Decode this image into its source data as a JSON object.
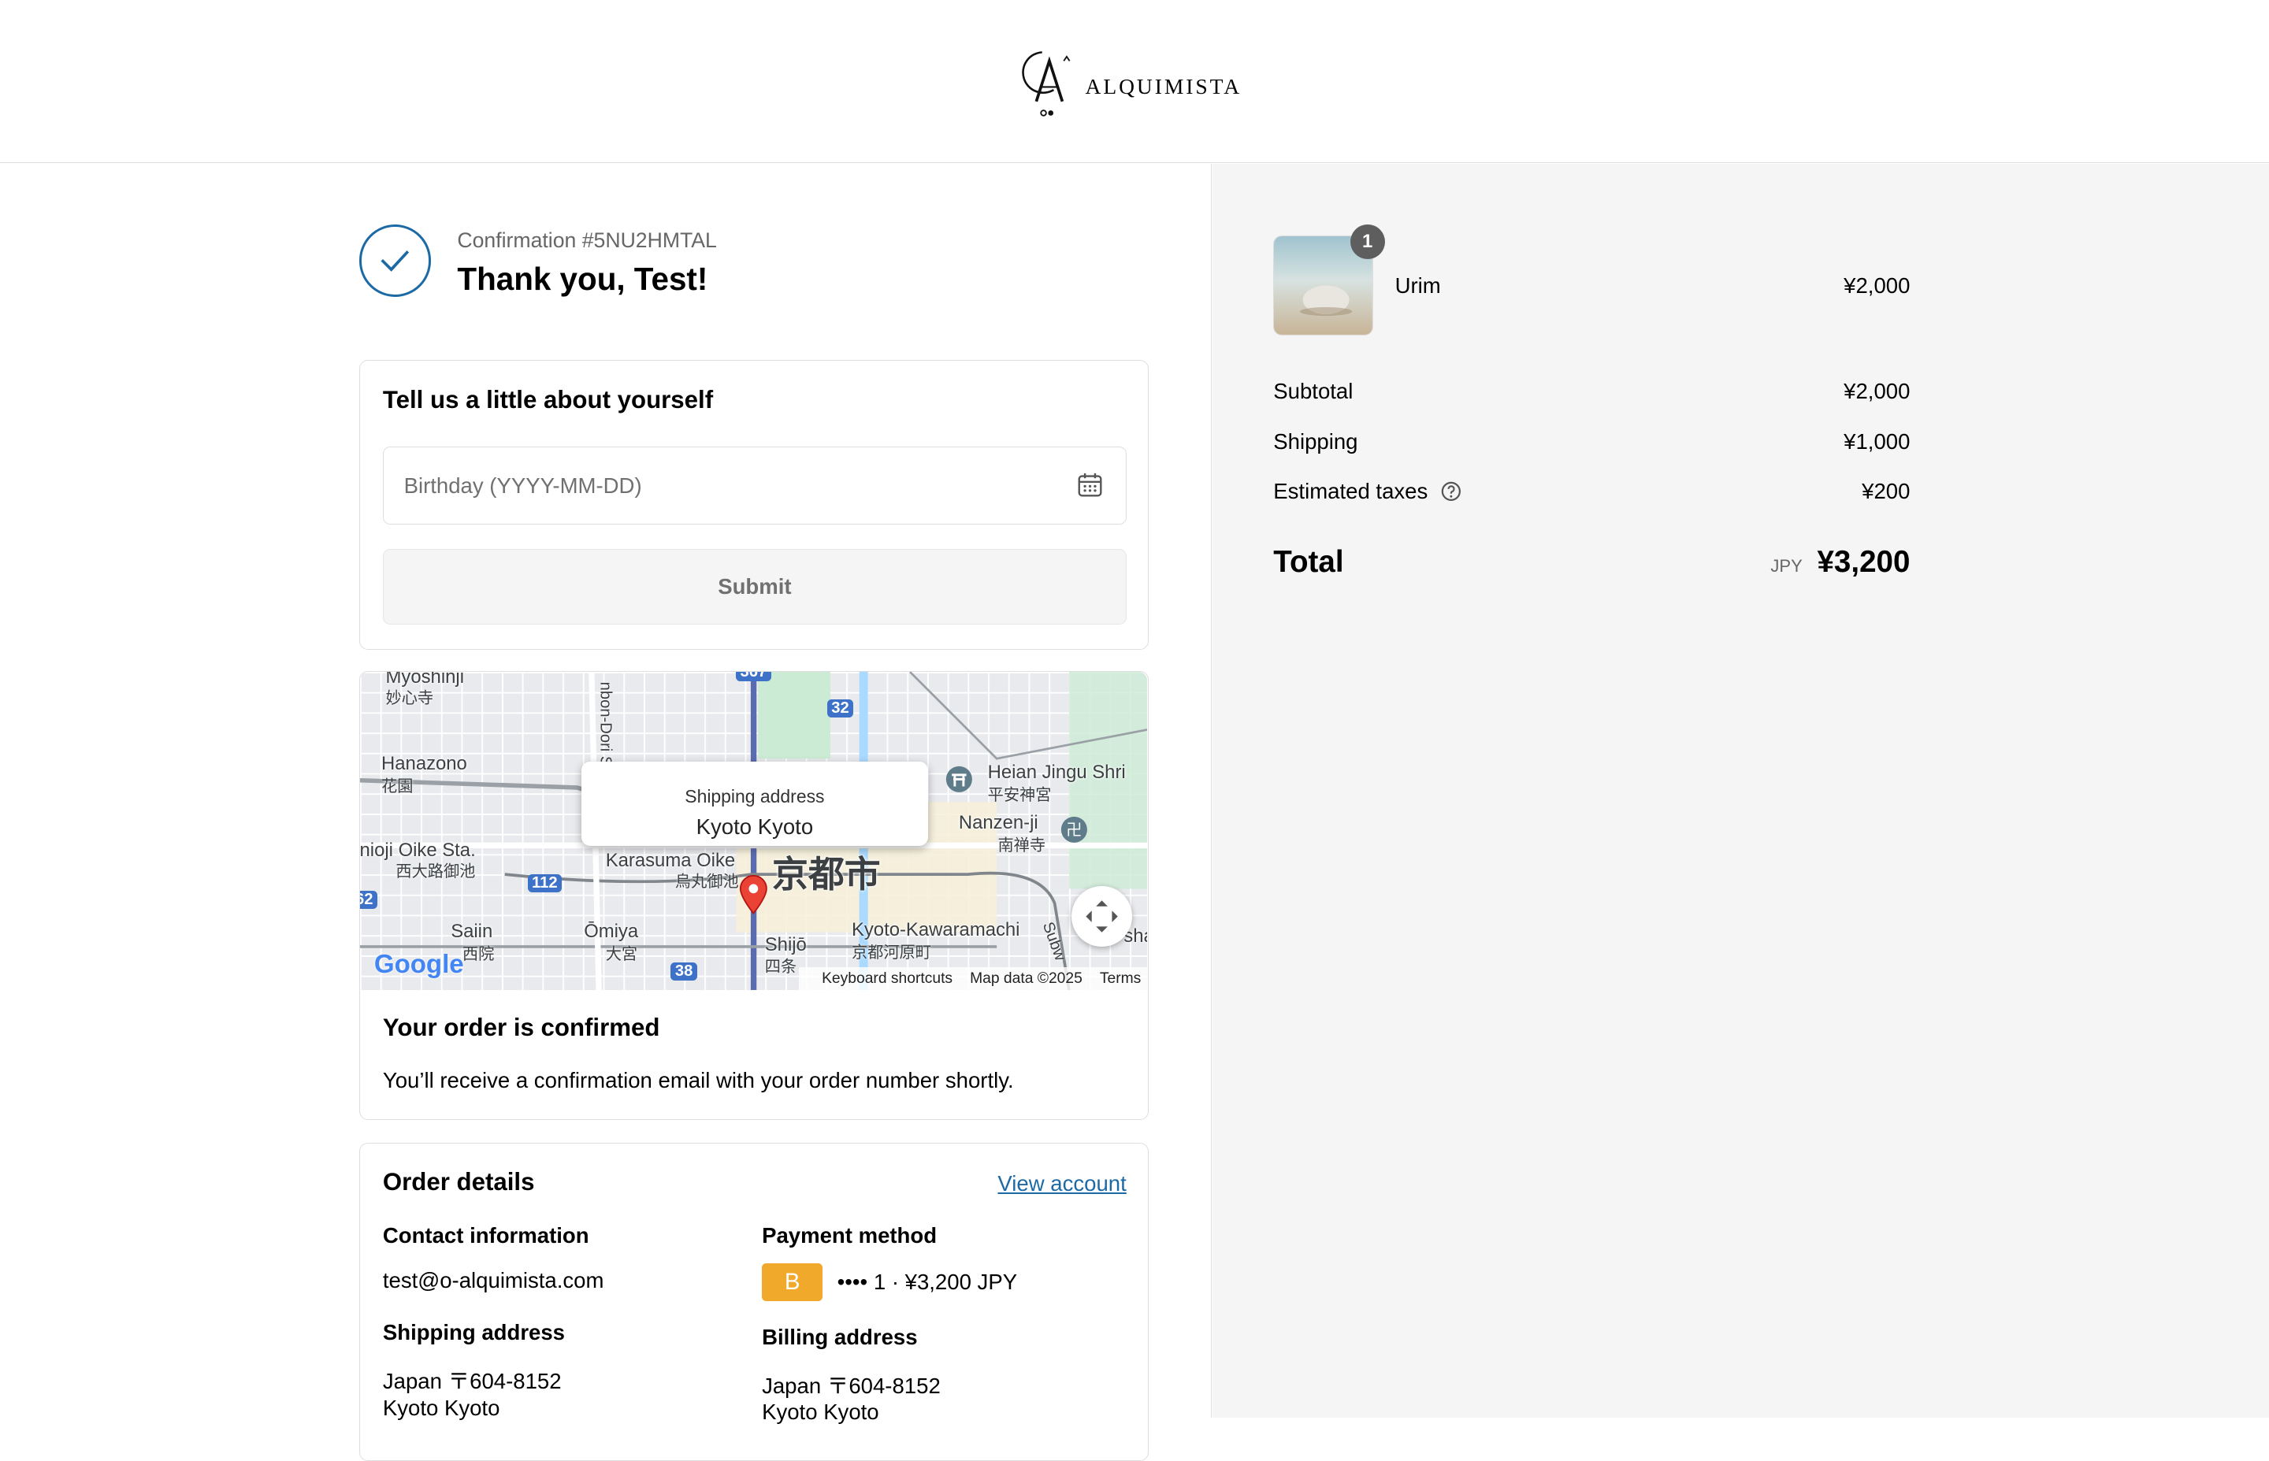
{
  "brand": {
    "name": "ALQUIMISTA"
  },
  "confirmation": {
    "number": "Confirmation #5NU2HMTAL",
    "title": "Thank you, Test!"
  },
  "about": {
    "title": "Tell us a little about yourself",
    "birthday_placeholder": "Birthday (YYYY-MM-DD)",
    "submit_label": "Submit"
  },
  "map": {
    "tooltip_label": "Shipping address",
    "tooltip_value": "Kyoto Kyoto",
    "labels": {
      "myoshinji": "Myoshinji",
      "myoshinji_jp": "妙心寺",
      "hanazono": "Hanazono",
      "hanazono_jp": "花園",
      "oike_sta": "nioji Oike Sta.",
      "oike_sta_jp": "西大路御池",
      "heian": "Heian Jingu Shri",
      "heian_jp": "平安神宮",
      "nanzenji": "Nanzen-ji",
      "nanzenji_jp": "南禅寺",
      "karasuma": "Karasuma Oike",
      "karasuma_jp": "烏丸御池",
      "kyoto_city": "京都市",
      "saiin": "Saiin",
      "saiin_jp": "西院",
      "omiya": "Ōmiya",
      "omiya_jp": "大宮",
      "shijo": "Shijō",
      "shijo_jp": "四条",
      "kawaramachi": "Kyoto-Kawaramachi",
      "kawaramachi_jp": "京都河原町",
      "senbon": "nbon-Dori S",
      "subway": "Subw",
      "sha": "sha",
      "route_32": "32",
      "route_112": "112",
      "route_38": "38",
      "route_367": "367",
      "route_62": "62"
    },
    "google": "Google",
    "attribution": {
      "shortcuts": "Keyboard shortcuts",
      "data": "Map data ©2025",
      "terms": "Terms"
    }
  },
  "order_confirmed": {
    "title": "Your order is confirmed",
    "message": "You’ll receive a confirmation email with your order number shortly."
  },
  "order_details": {
    "title": "Order details",
    "view_account": "View account",
    "contact_label": "Contact information",
    "contact_value": "test@o-alquimista.com",
    "payment_label": "Payment method",
    "payment_badge": "B",
    "payment_value": "•••• 1 · ¥3,200 JPY",
    "shipping_label": "Shipping address",
    "shipping_line1": "Japan 〒604-8152",
    "shipping_line2": "Kyoto Kyoto",
    "billing_label": "Billing address",
    "billing_line1": "Japan 〒604-8152",
    "billing_line2": "Kyoto Kyoto"
  },
  "summary": {
    "item": {
      "name": "Urim",
      "price": "¥2,000",
      "quantity": "1"
    },
    "subtotal_label": "Subtotal",
    "subtotal_value": "¥2,000",
    "shipping_label": "Shipping",
    "shipping_value": "¥1,000",
    "taxes_label": "Estimated taxes",
    "taxes_value": "¥200",
    "total_label": "Total",
    "currency": "JPY",
    "total_value": "¥3,200"
  },
  "colors": {
    "accent": "#1c6aa5",
    "payment_badge": "#f0a92a",
    "summary_bg": "#f5f5f5",
    "map_pin": "#ea4335"
  }
}
